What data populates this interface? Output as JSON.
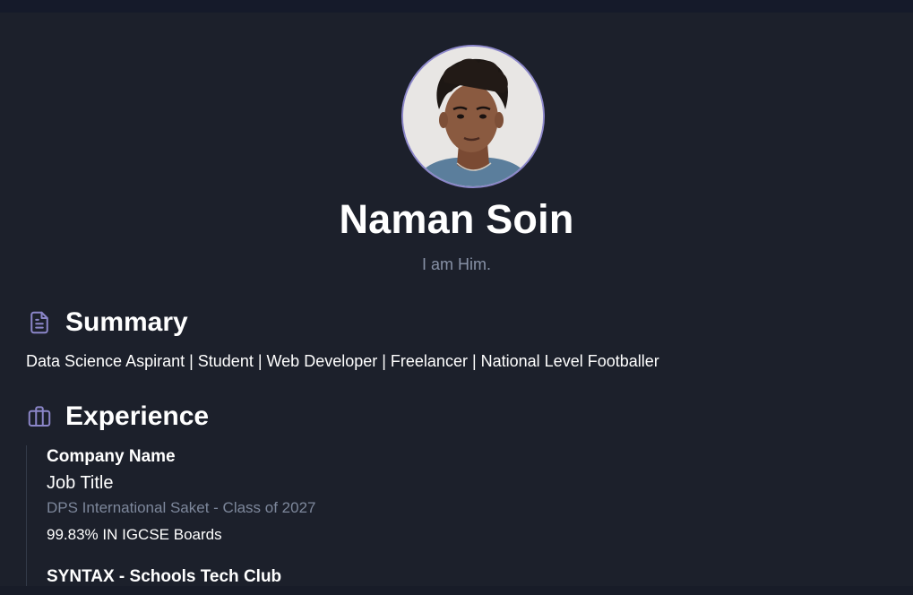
{
  "profile": {
    "name": "Naman Soin",
    "tagline": "I am Him."
  },
  "summary": {
    "heading": "Summary",
    "text": "Data Science Aspirant | Student | Web Developer | Freelancer | National Level Footballer"
  },
  "experience": {
    "heading": "Experience",
    "items": [
      {
        "company": "Company Name",
        "title": "Job Title",
        "subtitle": "DPS International Saket - Class of 2027",
        "description": "99.83% IN IGCSE Boards"
      },
      {
        "company": "SYNTAX - Schools Tech Club"
      }
    ]
  },
  "icons": {
    "summary": "document-icon",
    "experience": "briefcase-icon"
  },
  "colors": {
    "background": "#1c202b",
    "accent": "#8b86c9",
    "muted_text": "#8791a6"
  }
}
